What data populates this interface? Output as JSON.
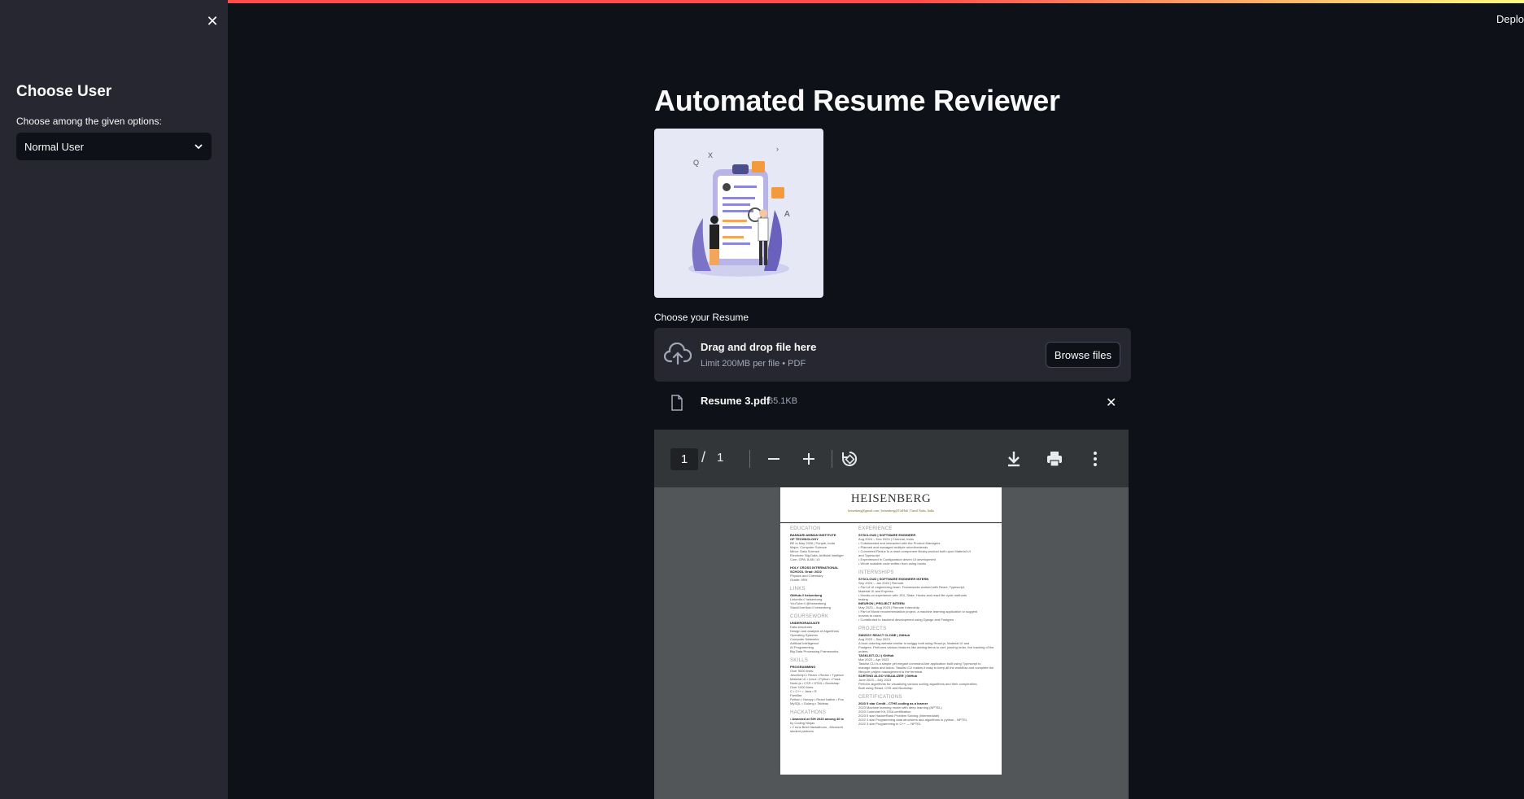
{
  "app": {
    "deploy_label": "Deplo"
  },
  "sidebar": {
    "close_symbol": "✕",
    "title": "Choose User",
    "select_label": "Choose among the given options:",
    "select_value": "Normal User"
  },
  "main": {
    "title": "Automated Resume Reviewer",
    "hero_image_icon": "resume-review-illustration",
    "uploader": {
      "label": "Choose your Resume",
      "drop_text": "Drag and drop file here",
      "limit_text": "Limit 200MB per file • PDF",
      "browse_label": "Browse files"
    },
    "file": {
      "name": "Resume 3.pdf",
      "size": "65.1KB",
      "remove_symbol": "✕"
    }
  },
  "pdf_viewer": {
    "current_page": "1",
    "separator": "/",
    "total_pages": "1",
    "icons": [
      "zoom-out-icon",
      "zoom-in-icon",
      "rotate-icon",
      "download-icon",
      "print-icon",
      "more-options-icon"
    ],
    "page": {
      "name": "HEISENBERG",
      "contact": "heisenberg@gmail.com | heisenberg@GitHub | Tamil Nadu, India",
      "left_sections": [
        {
          "heading": "EDUCATION",
          "lines": [
            "BANNARI AMMAN INSTITUTE",
            "OF TECHNOLOGY",
            "BE in May 2026 | Punjab, India",
            "Major: Computer Science",
            "Minor: Data Science",
            "Electives: Big Data, Artificial Intelligence",
            "Cum. GPA: 8.88 / 10",
            "",
            "HOLY CROSS INTERNATIONAL",
            "SCHOOL Grad: 2022",
            "Physics and Chemistry",
            "Grade: 95%"
          ]
        },
        {
          "heading": "LINKS",
          "lines": [
            "GitHub:// heisenberg",
            "LinkedIn:// heisenberg",
            "YouTube:// @heisenberg",
            "StackOverflow:// heisenberg"
          ]
        },
        {
          "heading": "COURSEWORK",
          "lines": [
            "UNDERGRADUATE",
            "Data structures",
            "Design and analysis of Algorithms",
            "Operating Systems",
            "Computer Networks",
            "Artificial Intelligence",
            "AI Programming",
            "Big Data Processing Frameworks"
          ]
        },
        {
          "heading": "SKILLS",
          "lines": [
            "PROGRAMMING",
            "Over 5000 lines:",
            "JavaScript • React • Redux • Typescript",
            "Material UI • Linux • Python • Flask",
            "Node.js • CSS • HTML • Bootstrap",
            "Over 1000 lines:",
            "C • C++ • Java • R",
            "Familiar:",
            "Python • Numpy • React Native • Postgres",
            "MySQL • Golang • Tableau"
          ]
        },
        {
          "heading": "HACKATHONS",
          "lines": [
            "• Awarded at SIH 2023 among 40 teams",
            "by Coding Ninjas",
            "• 2 runs Best Hackathons - Microsoft",
            "student partners"
          ]
        }
      ],
      "right_sections": [
        {
          "heading": "EXPERIENCE",
          "lines": [
            "SYSCLOUD | SOFTWARE ENGINEER",
            "Aug 2024 – Dec 2024 | Chennai, India",
            "• Collaborated and interacted with the Product Managers",
            "• Planned and managed multiple microfrontends",
            "• Converted Redux to a react component library product built upon Material UI",
            "  and Typescript",
            "• Experienced in Configuration driven UI development",
            "• Wrote scalable code written from using hooks"
          ]
        },
        {
          "heading": "INTERNSHIPS",
          "lines": [
            "SYSCLOUD | SOFTWARE ENGINEER INTERN",
            "Sep 2024 – Jan 2024 | Remote",
            "• Part of UI engineering team. Frameworks worked with React, Typescript,",
            "  Material UI and Express.",
            "• Hands-on experience with JSX, State, Hooks and react life cycle methods",
            "  testing",
            "INEURON | PROJECT INTERN",
            "May 2023 – Aug 2023 | Remote Internship",
            "• Part of Movie recommendation project, a machine learning application to suggest",
            "  movies to users.",
            "• Contributed to backend development using Django and Postgres"
          ]
        },
        {
          "heading": "PROJECTS",
          "lines": [
            "SWIGGY REACT CLONE | GitHub",
            "Aug 2023 – Sep 2023",
            "A food ordering website similar to swiggy built using React.js, Material UI and",
            "Postgres. Performs various features like adding items to cart, placing order, live tracking of the",
            "orders.",
            "TASKLIST-CLI | GitHub",
            "Mar 2023 – Apr 2023",
            "Tasklist CLI is a simple yet elegant command-line application built using Typescript to",
            "manage tasks and todos. Tasklist CLI makes it easy to keep all the workflow and complete the",
            "lifecycle project management to the terminal.",
            "SORTING ALGO VISUALIZER | GitHub",
            "June 2023 – July 2023",
            "Perform algorithms for visualizing various sorting algorithms and their complexities",
            "Built using React, CSS and Bootstrap"
          ]
        },
        {
          "heading": "CERTIFICATIONS",
          "lines": [
            "2023    5 star    Credit - CTHS coding as a learner",
            "2023             Machine learning model with deep learning (NPTEL)",
            "2023             Codechef Kit, DSA certification",
            "2023    5 star   HackerRank Problem Solving (Intermediate)",
            "2022    3 star   Programming data structures and algorithms in python - NPTEL",
            "2022    3 star   Programming in C++ — NPTEL"
          ]
        }
      ]
    }
  },
  "colors": {
    "accent": "#ff4b4b",
    "sidebar_bg": "#262730",
    "main_bg": "#0e1117"
  }
}
